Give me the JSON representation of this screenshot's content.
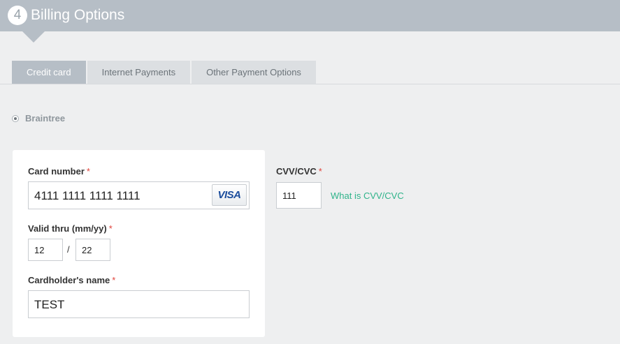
{
  "header": {
    "step": "4",
    "title": "Billing Options"
  },
  "tabs": [
    {
      "label": "Credit card",
      "active": true
    },
    {
      "label": "Internet Payments",
      "active": false
    },
    {
      "label": "Other Payment Options",
      "active": false
    }
  ],
  "payment_method": {
    "label": "Braintree",
    "selected": true
  },
  "card_form": {
    "card_number_label": "Card number",
    "required_mark": "*",
    "card_number_value": "4111 1111 1111 1111",
    "card_brand": "VISA",
    "valid_thru_label": "Valid thru (mm/yy)",
    "month_value": "12",
    "separator": "/",
    "year_value": "22",
    "cardholder_label": "Cardholder's name",
    "cardholder_value": "TEST",
    "cvv_label": "CVV/CVC",
    "cvv_value": "111",
    "cvv_help_link": "What is CVV/CVC"
  },
  "colors": {
    "header_bg": "#b6bec6",
    "active_tab_bg": "#b6bec6",
    "required": "#e0433b",
    "link": "#2fb38a"
  }
}
